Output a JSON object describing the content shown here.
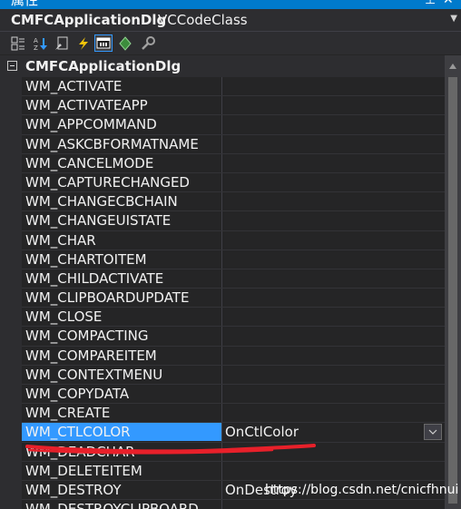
{
  "window": {
    "title": "属性",
    "pin_glyph": "⊥",
    "close_glyph": "✕"
  },
  "selector": {
    "object_name": "CMFCApplicationDlg",
    "class_name": "VCCodeClass"
  },
  "toolbar": {
    "buttons": [
      {
        "icon": "categorized-icon",
        "active": false
      },
      {
        "icon": "alphabetical-icon",
        "active": false
      },
      {
        "icon": "properties-page-icon",
        "active": false
      },
      {
        "icon": "events-icon",
        "active": false
      },
      {
        "icon": "messages-icon",
        "active": true
      },
      {
        "icon": "overrides-icon",
        "active": false
      },
      {
        "icon": "property-pages-icon",
        "active": false
      }
    ]
  },
  "grid": {
    "category": "CMFCApplicationDlg",
    "rows": [
      {
        "name": "WM_ACTIVATE",
        "value": ""
      },
      {
        "name": "WM_ACTIVATEAPP",
        "value": ""
      },
      {
        "name": "WM_APPCOMMAND",
        "value": ""
      },
      {
        "name": "WM_ASKCBFORMATNAME",
        "value": ""
      },
      {
        "name": "WM_CANCELMODE",
        "value": ""
      },
      {
        "name": "WM_CAPTURECHANGED",
        "value": ""
      },
      {
        "name": "WM_CHANGECBCHAIN",
        "value": ""
      },
      {
        "name": "WM_CHANGEUISTATE",
        "value": ""
      },
      {
        "name": "WM_CHAR",
        "value": ""
      },
      {
        "name": "WM_CHARTOITEM",
        "value": ""
      },
      {
        "name": "WM_CHILDACTIVATE",
        "value": ""
      },
      {
        "name": "WM_CLIPBOARDUPDATE",
        "value": ""
      },
      {
        "name": "WM_CLOSE",
        "value": ""
      },
      {
        "name": "WM_COMPACTING",
        "value": ""
      },
      {
        "name": "WM_COMPAREITEM",
        "value": ""
      },
      {
        "name": "WM_CONTEXTMENU",
        "value": ""
      },
      {
        "name": "WM_COPYDATA",
        "value": ""
      },
      {
        "name": "WM_CREATE",
        "value": ""
      },
      {
        "name": "WM_CTLCOLOR",
        "value": "OnCtlColor",
        "selected": true
      },
      {
        "name": "WM_DEADCHAR",
        "value": ""
      },
      {
        "name": "WM_DELETEITEM",
        "value": ""
      },
      {
        "name": "WM_DESTROY",
        "value": "OnDestroy"
      },
      {
        "name": "WM_DESTROYCLIPBOARD",
        "value": ""
      }
    ]
  },
  "watermark": "https://blog.csdn.net/cnicfhnui",
  "colors": {
    "background": "#252526",
    "selection": "#3399ff",
    "annotation": "#e8202a",
    "text": "#f1f1f1"
  }
}
